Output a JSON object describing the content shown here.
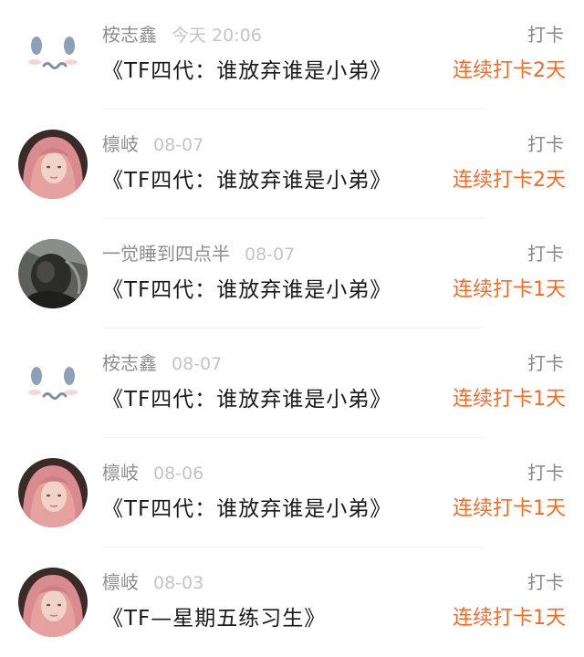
{
  "action_label": "打卡",
  "rows": [
    {
      "avatar": "ghost-face",
      "name": "桉志鑫",
      "time": "今天 20:06",
      "title": "《TF四代：谁放弃谁是小弟》",
      "streak": "连续打卡2天"
    },
    {
      "avatar": "pink-hair-girl",
      "name": "檩岐",
      "time": "08-07",
      "title": "《TF四代：谁放弃谁是小弟》",
      "streak": "连续打卡2天"
    },
    {
      "avatar": "dark-photo",
      "name": "一觉睡到四点半",
      "time": "08-07",
      "title": "《TF四代：谁放弃谁是小弟》",
      "streak": "连续打卡1天"
    },
    {
      "avatar": "ghost-face",
      "name": "桉志鑫",
      "time": "08-07",
      "title": "《TF四代：谁放弃谁是小弟》",
      "streak": "连续打卡1天"
    },
    {
      "avatar": "pink-hair-girl",
      "name": "檩岐",
      "time": "08-06",
      "title": "《TF四代：谁放弃谁是小弟》",
      "streak": "连续打卡1天"
    },
    {
      "avatar": "pink-hair-girl",
      "name": "檩岐",
      "time": "08-03",
      "title": "《TF—星期五练习生》",
      "streak": "连续打卡1天"
    }
  ]
}
